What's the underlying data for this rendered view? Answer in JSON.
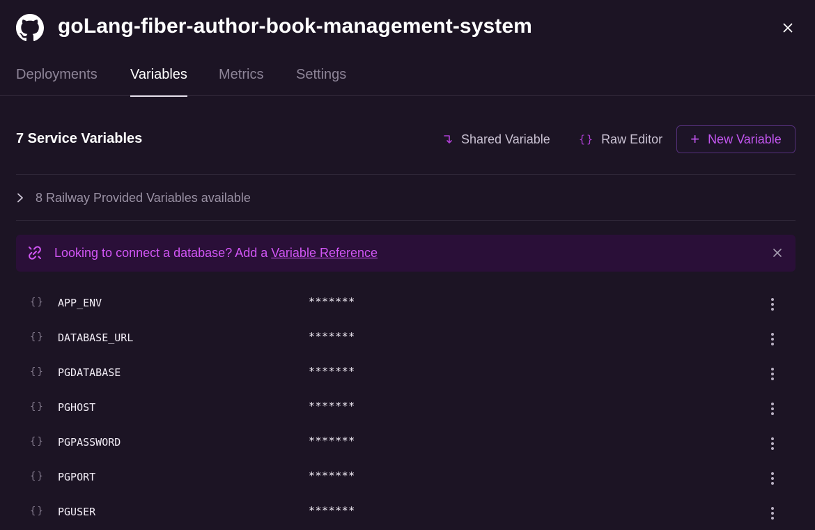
{
  "header": {
    "title": "goLang-fiber-author-book-management-system",
    "logo_icon": "github-icon",
    "close_icon": "close-icon"
  },
  "tabs": [
    {
      "label": "Deployments",
      "active": false
    },
    {
      "label": "Variables",
      "active": true
    },
    {
      "label": "Metrics",
      "active": false
    },
    {
      "label": "Settings",
      "active": false
    }
  ],
  "section": {
    "title": "7 Service Variables",
    "shared_variable_label": "Shared Variable",
    "raw_editor_label": "Raw Editor",
    "new_variable_label": "New Variable"
  },
  "provided": {
    "label": "8 Railway Provided Variables available"
  },
  "banner": {
    "text": "Looking to connect a database? Add a ",
    "link": "Variable Reference"
  },
  "variables": [
    {
      "name": "APP_ENV",
      "value": "*******"
    },
    {
      "name": "DATABASE_URL",
      "value": "*******"
    },
    {
      "name": "PGDATABASE",
      "value": "*******"
    },
    {
      "name": "PGHOST",
      "value": "*******"
    },
    {
      "name": "PGPASSWORD",
      "value": "*******"
    },
    {
      "name": "PGPORT",
      "value": "*******"
    },
    {
      "name": "PGUSER",
      "value": "*******"
    }
  ],
  "colors": {
    "background": "#1c1424",
    "accent": "#c356f0",
    "banner_bg": "#2a0f38",
    "muted_text": "#8d8497"
  }
}
